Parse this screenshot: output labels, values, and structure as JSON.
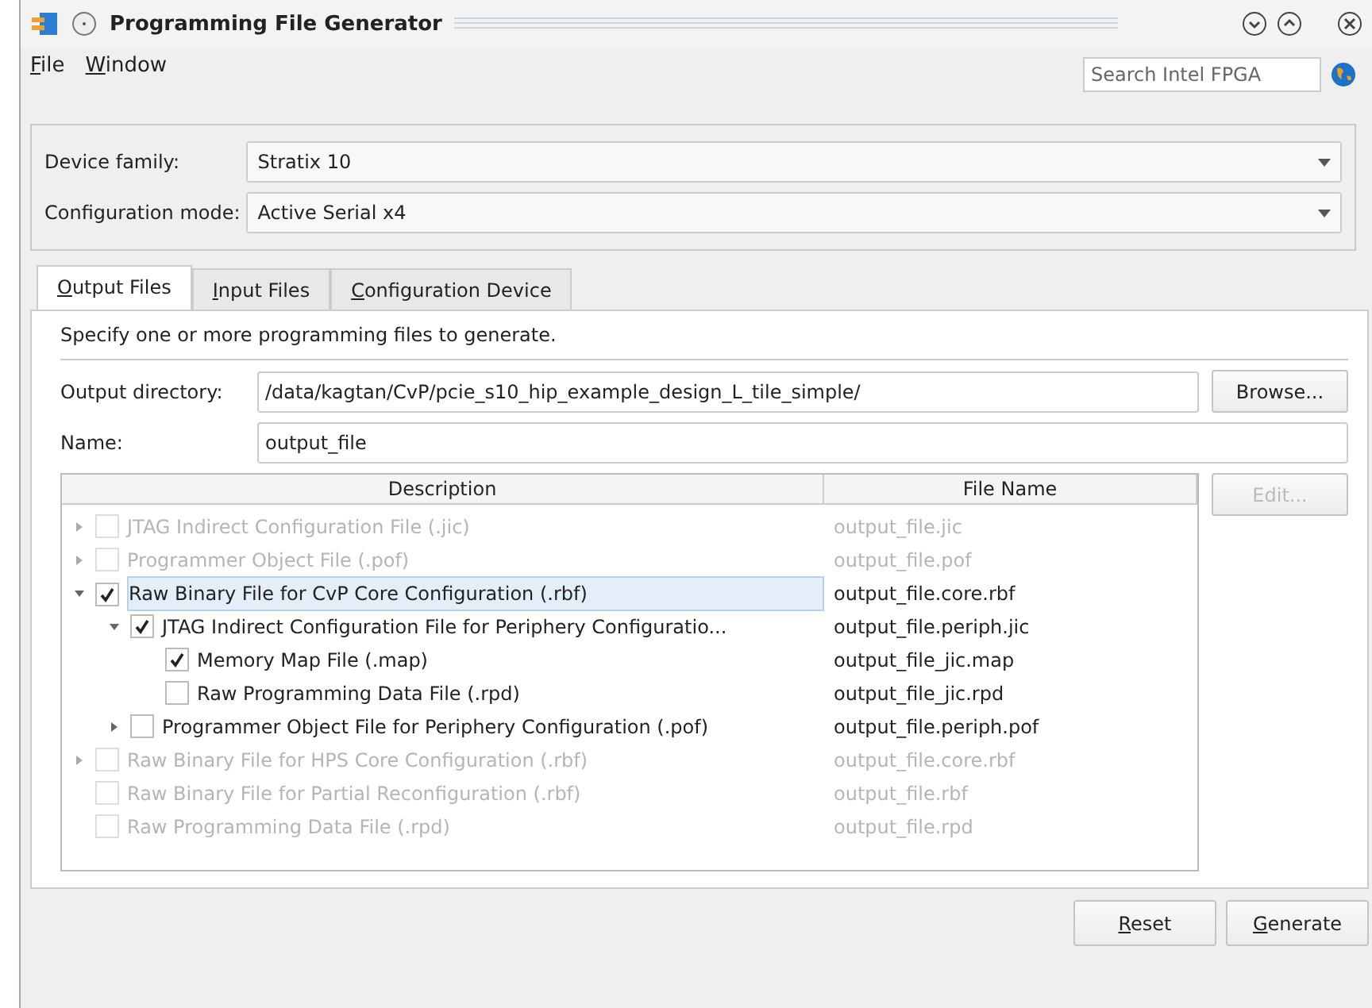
{
  "window": {
    "title": "Programming File Generator"
  },
  "menu": [
    {
      "label": "File"
    },
    {
      "label": "Window"
    }
  ],
  "search": {
    "placeholder": "Search Intel FPGA"
  },
  "device_family": {
    "label": "Device family:",
    "value": "Stratix 10"
  },
  "configuration_mode": {
    "label": "Configuration mode:",
    "value": "Active Serial x4"
  },
  "tabs": [
    {
      "label": "Output Files",
      "selected": true
    },
    {
      "label": "Input Files",
      "selected": false
    },
    {
      "label": "Configuration Device",
      "selected": false
    }
  ],
  "instructions": "Specify one or more programming files to generate.",
  "output_directory": {
    "label": "Output directory:",
    "value": "/data/kagtan/CvP/pcie_s10_hip_example_design_L_tile_simple/",
    "button": "Browse..."
  },
  "name": {
    "label": "Name:",
    "value": "output_file"
  },
  "table": {
    "columns": [
      "Description",
      "File Name"
    ],
    "rows": [
      {
        "kind": "branch",
        "description": "JTAG Indirect Configuration File (.jic)",
        "file_name": "output_file.jic",
        "checked": false,
        "disabled": true,
        "expanded": false,
        "selected": false
      },
      {
        "kind": "branch",
        "description": "Programmer Object File (.pof)",
        "file_name": "output_file.pof",
        "checked": false,
        "disabled": true,
        "expanded": false,
        "selected": false
      },
      {
        "kind": "branch",
        "description": "Raw Binary File for CvP Core Configuration (.rbf)",
        "file_name": "output_file.core.rbf",
        "checked": true,
        "disabled": false,
        "expanded": true,
        "selected": true,
        "children": [
          {
            "kind": "branch",
            "description": "JTAG Indirect Configuration File for Periphery Configuratio...",
            "file_name": "output_file.periph.jic",
            "checked": true,
            "disabled": false,
            "expanded": true,
            "selected": false,
            "children": [
              {
                "kind": "leaf",
                "description": "Memory Map File (.map)",
                "file_name": "output_file_jic.map",
                "checked": true,
                "disabled": false,
                "selected": false
              },
              {
                "kind": "leaf",
                "description": "Raw Programming Data File (.rpd)",
                "file_name": "output_file_jic.rpd",
                "checked": false,
                "disabled": false,
                "selected": false
              }
            ]
          },
          {
            "kind": "branch",
            "description": "Programmer Object File for Periphery Configuration (.pof)",
            "file_name": "output_file.periph.pof",
            "checked": false,
            "disabled": false,
            "expanded": false,
            "selected": false
          }
        ]
      },
      {
        "kind": "branch",
        "description": "Raw Binary File for HPS Core Configuration (.rbf)",
        "file_name": "output_file.core.rbf",
        "checked": false,
        "disabled": true,
        "expanded": false,
        "selected": false
      },
      {
        "kind": "leaf",
        "description": "Raw Binary File for Partial Reconfiguration (.rbf)",
        "file_name": "output_file.rbf",
        "checked": false,
        "disabled": true,
        "selected": false
      },
      {
        "kind": "leaf",
        "description": "Raw Programming Data File (.rpd)",
        "file_name": "output_file.rpd",
        "checked": false,
        "disabled": true,
        "selected": false
      }
    ]
  },
  "edit_button": {
    "label": "Edit...",
    "disabled": true
  },
  "buttons": [
    {
      "label": "Reset"
    },
    {
      "label": "Generate"
    }
  ]
}
